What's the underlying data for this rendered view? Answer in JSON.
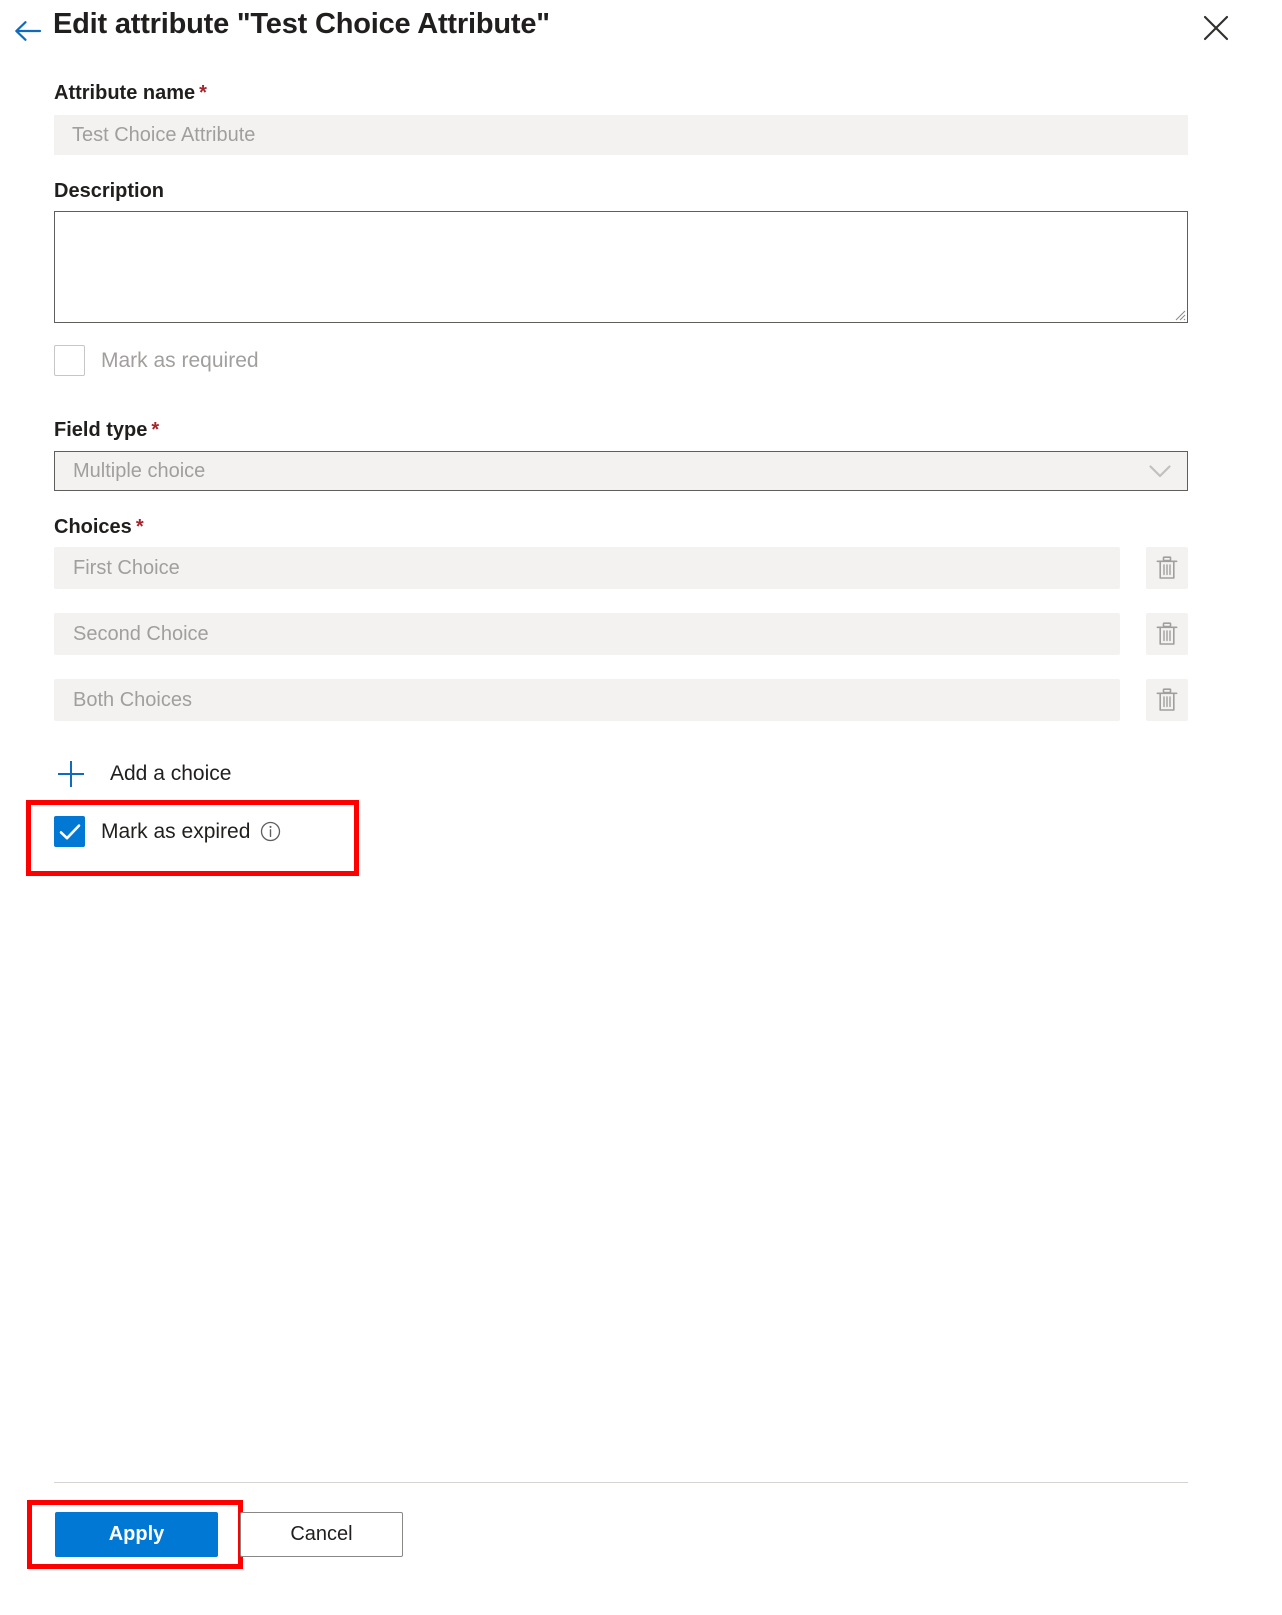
{
  "header": {
    "back_icon": "arrow-left-icon",
    "title": "Edit attribute \"Test Choice Attribute\"",
    "close_icon": "close-icon"
  },
  "form": {
    "attribute_name": {
      "label": "Attribute name",
      "required_marker": "*",
      "value": "",
      "placeholder": "Test Choice Attribute",
      "disabled": true
    },
    "description": {
      "label": "Description",
      "value": "",
      "placeholder": ""
    },
    "mark_as_required": {
      "label": "Mark as required",
      "checked": false,
      "disabled": true
    },
    "field_type": {
      "label": "Field type",
      "required_marker": "*",
      "selected": "Multiple choice",
      "chevron_icon": "chevron-down-icon",
      "disabled": true
    },
    "choices": {
      "label": "Choices",
      "required_marker": "*",
      "items": [
        {
          "placeholder": "First Choice",
          "delete_icon": "trash-icon"
        },
        {
          "placeholder": "Second Choice",
          "delete_icon": "trash-icon"
        },
        {
          "placeholder": "Both Choices",
          "delete_icon": "trash-icon"
        }
      ],
      "add_label": "Add a choice",
      "add_icon": "plus-icon"
    },
    "mark_as_expired": {
      "label": "Mark as expired",
      "checked": true,
      "info_icon": "info-icon"
    }
  },
  "footer": {
    "apply_label": "Apply",
    "cancel_label": "Cancel"
  },
  "colors": {
    "accent": "#0078d4",
    "highlight": "#ff0000",
    "required_star": "#a4262c",
    "disabled_fill": "#f3f2f1",
    "disabled_text": "#a19f9d"
  }
}
